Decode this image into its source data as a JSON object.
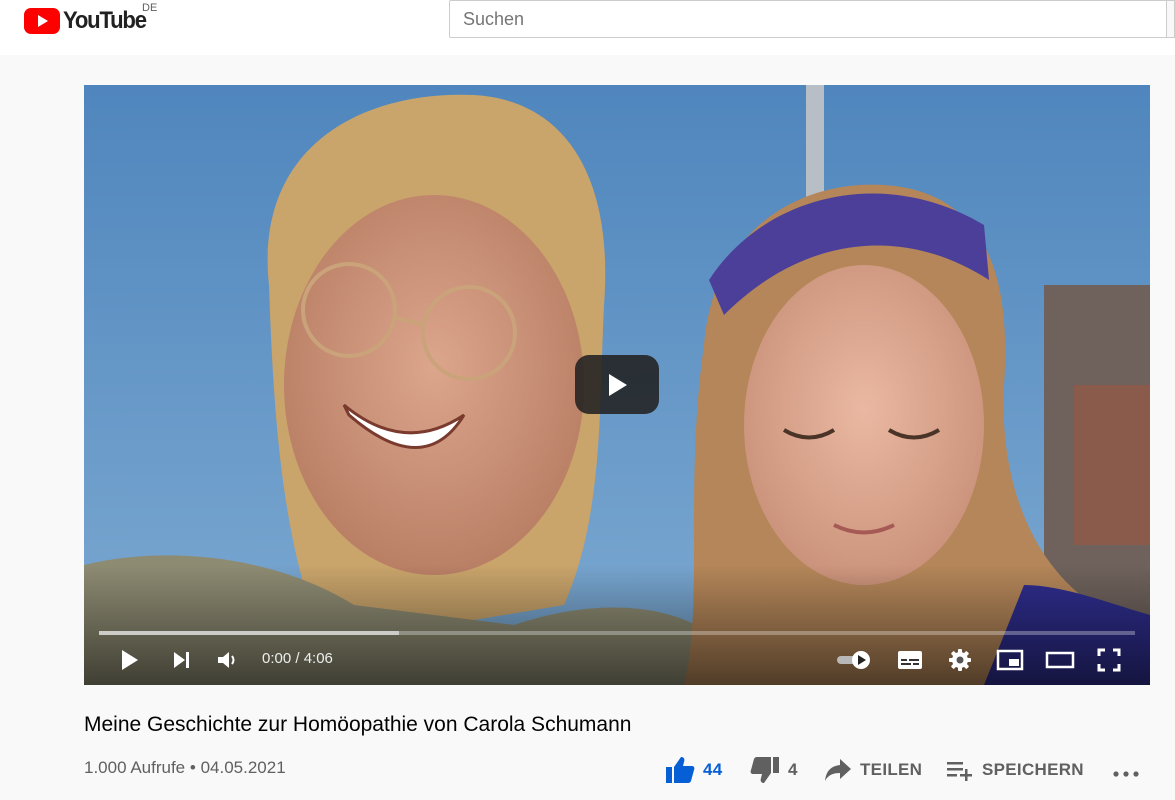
{
  "header": {
    "logo_text": "YouTube",
    "country_code": "DE",
    "search_placeholder": "Suchen"
  },
  "player": {
    "time_display": "0:00 / 4:06",
    "progress_loaded": 0.29,
    "icons": [
      "play-icon",
      "next-icon",
      "volume-icon",
      "autoplay-toggle-icon",
      "subtitles-icon",
      "settings-icon",
      "miniplayer-icon",
      "theater-mode-icon",
      "fullscreen-icon"
    ]
  },
  "video": {
    "title": "Meine Geschichte zur Homöopathie von Carola Schumann",
    "views": "1.000 Aufrufe",
    "separator": "•",
    "date": "04.05.2021"
  },
  "actions": {
    "like_count": "44",
    "dislike_count": "4",
    "share_label": "TEILEN",
    "save_label": "SPEICHERN"
  },
  "colors": {
    "brand_red": "#ff0000",
    "like_blue": "#065fd4",
    "text_secondary": "#606060"
  }
}
